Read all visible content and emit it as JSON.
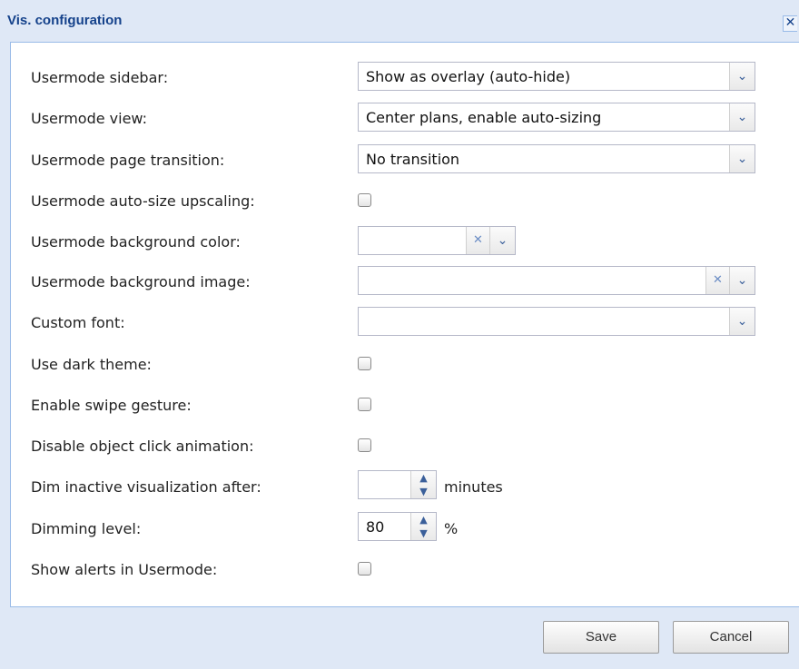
{
  "dialog": {
    "title": "Vis. configuration",
    "close_glyph": "✕"
  },
  "fields": {
    "sidebar": {
      "label": "Usermode sidebar:",
      "value": "Show as overlay (auto-hide)"
    },
    "view": {
      "label": "Usermode view:",
      "value": "Center plans, enable auto-sizing"
    },
    "transition": {
      "label": "Usermode page transition:",
      "value": "No transition"
    },
    "upscaling": {
      "label": "Usermode auto-size upscaling:",
      "checked": false
    },
    "bg_color": {
      "label": "Usermode background color:",
      "value": ""
    },
    "bg_image": {
      "label": "Usermode background image:",
      "value": ""
    },
    "custom_font": {
      "label": "Custom font:",
      "value": ""
    },
    "dark_theme": {
      "label": "Use dark theme:",
      "checked": false
    },
    "swipe": {
      "label": "Enable swipe gesture:",
      "checked": false
    },
    "click_animation": {
      "label": "Disable object click animation:",
      "checked": false
    },
    "dim_after": {
      "label": "Dim inactive visualization after:",
      "value": "",
      "unit": "minutes"
    },
    "dim_level": {
      "label": "Dimming level:",
      "value": "80",
      "unit": "%"
    },
    "alerts": {
      "label": "Show alerts in Usermode:",
      "checked": false
    }
  },
  "icons": {
    "chevron": "chevron-down-icon",
    "clear": "clear-x-icon",
    "spin_up": "spinner-up-icon",
    "spin_down": "spinner-down-icon"
  },
  "glyphs": {
    "chevron": "⌄",
    "clear": "✕",
    "up": "▲",
    "down": "▼"
  },
  "buttons": {
    "save": "Save",
    "cancel": "Cancel"
  },
  "colors": {
    "header_bg": "#dfe8f6",
    "title_text": "#15428b",
    "border": "#99bbe8"
  }
}
